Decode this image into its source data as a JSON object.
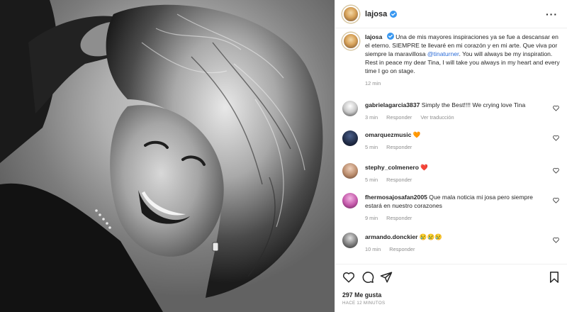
{
  "post": {
    "username": "lajosa",
    "caption_text": "Una de mis mayores inspiraciones ya se fue a descansar en el eterno. SIEMPRE te llevaré en mi corazón y en mi arte. Que viva por siempre la maravillosa ",
    "caption_mention": "@tinaturner",
    "caption_text_2": ". You will always be my inspiration. Rest in peace my dear Tina, I will take you always in my heart and every time I go on stage.",
    "caption_time": "12 min"
  },
  "labels": {
    "reply": "Responder",
    "view_translation": "Ver traducción"
  },
  "comments": [
    {
      "user": "gabrielagarcia3837",
      "text": "Simply the Best!!!! We crying love Tina",
      "time": "3 min",
      "show_translation": true,
      "avatar_color": "#c8c8c8"
    },
    {
      "user": "omarquezmusic",
      "text": "🧡",
      "time": "5 min",
      "show_translation": false,
      "avatar_color": "#1f2a44"
    },
    {
      "user": "stephy_colmenero",
      "text": "❤️",
      "time": "5 min",
      "show_translation": false,
      "avatar_color": "#b88a6a"
    },
    {
      "user": "fhermosajosafan2005",
      "text": "Que mala noticia mi josa pero siempre estará en nuestro corazones",
      "time": "9 min",
      "show_translation": false,
      "avatar_color": "#c256a8"
    },
    {
      "user": "armando.donckier",
      "text": "😢😢😢",
      "time": "10 min",
      "show_translation": false,
      "avatar_color": "#7a7a7a"
    }
  ],
  "footer": {
    "likes": "297 Me gusta",
    "posted_ago": "HACE 12 MINUTOS"
  },
  "icons": {
    "like": "heart-icon",
    "comment": "comment-icon",
    "share": "share-icon",
    "save": "bookmark-icon",
    "more": "more-options-icon",
    "verified": "verified-badge-icon"
  },
  "colors": {
    "verified_blue": "#3897f0",
    "mention_blue": "#2b6cd8",
    "muted": "#8e8e8e"
  }
}
